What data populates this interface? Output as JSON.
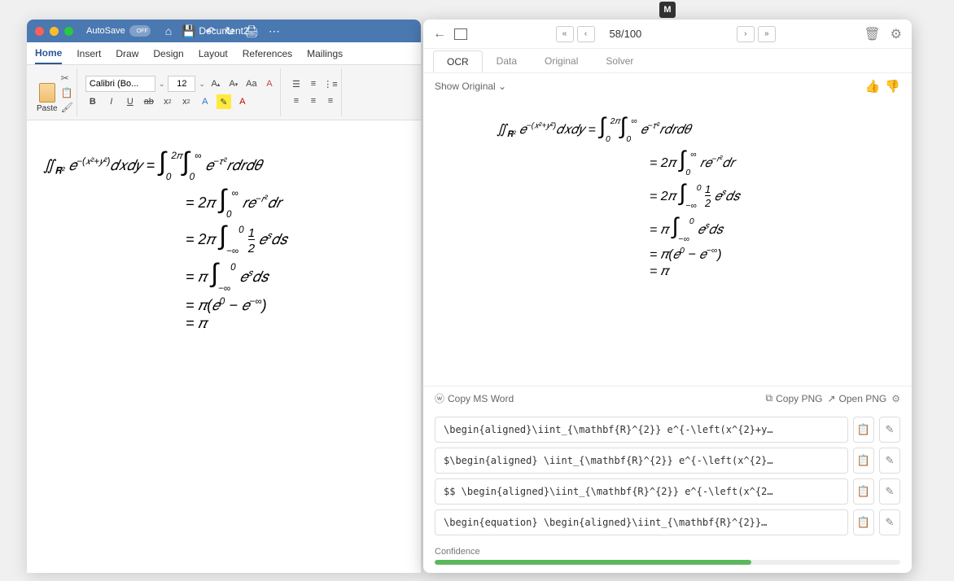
{
  "word": {
    "autosave_label": "AutoSave",
    "autosave_state": "OFF",
    "title": "Document2",
    "tabs": [
      "Home",
      "Insert",
      "Draw",
      "Design",
      "Layout",
      "References",
      "Mailings"
    ],
    "active_tab": 0,
    "paste_label": "Paste",
    "font_name": "Calibri (Bo...",
    "font_size": "12",
    "equations": [
      "∬<sub>𝐑²</sub> e<sup>−(x²+y²)</sup>dxdy = ∫<sub>0</sub><sup>2π</sup>∫<sub>0</sub><sup>∞</sup> e<sup>−τ²</sup>rdrdθ",
      "= 2π ∫<sub>0</sub><sup>∞</sup> re<sup>−r²</sup>dr",
      "= 2π ∫<sub>−∞</sub><sup>0</sup> ½ e<sup>s</sup>ds",
      "= π ∫<sub>−∞</sub><sup>0</sup> e<sup>s</sup>ds",
      "= π(e<sup>0</sup> − e<sup>−∞</sup>)",
      "= π"
    ]
  },
  "panel": {
    "counter": "58/100",
    "tabs": [
      "OCR",
      "Data",
      "Original",
      "Solver"
    ],
    "active_tab": 0,
    "show_label": "Show Original",
    "equations": [
      "∬<sub>𝐑²</sub> e<sup>−(x²+y²)</sup>dxdy = ∫<sub>0</sub><sup>2π</sup>∫<sub>0</sub><sup>∞</sup> e<sup>−τ²</sup>rdrdθ",
      "= 2π ∫<sub>0</sub><sup>∞</sup> re<sup>−r²</sup>dr",
      "= 2π ∫<sub>−∞</sub><sup>0</sup> ½ e<sup>s</sup>ds",
      "= π ∫<sub>−∞</sub><sup>0</sup> e<sup>s</sup>ds",
      "= π(e<sup>0</sup> − e<sup>−∞</sup>)",
      "= π"
    ],
    "copy_msword": "Copy MS Word",
    "copy_png": "Copy PNG",
    "open_png": "Open PNG",
    "latex": [
      "\\begin{aligned}\\iint_{\\mathbf{R}^{2}} e^{-\\left(x^{2}+y…",
      "$\\begin{aligned} \\iint_{\\mathbf{R}^{2}} e^{-\\left(x^{2}…",
      "$$ \\begin{aligned}\\iint_{\\mathbf{R}^{2}} e^{-\\left(x^{2…",
      "\\begin{equation} \\begin{aligned}\\iint_{\\mathbf{R}^{2}}…"
    ],
    "confidence_label": "Confidence",
    "confidence_pct": 68
  },
  "logo": "M"
}
